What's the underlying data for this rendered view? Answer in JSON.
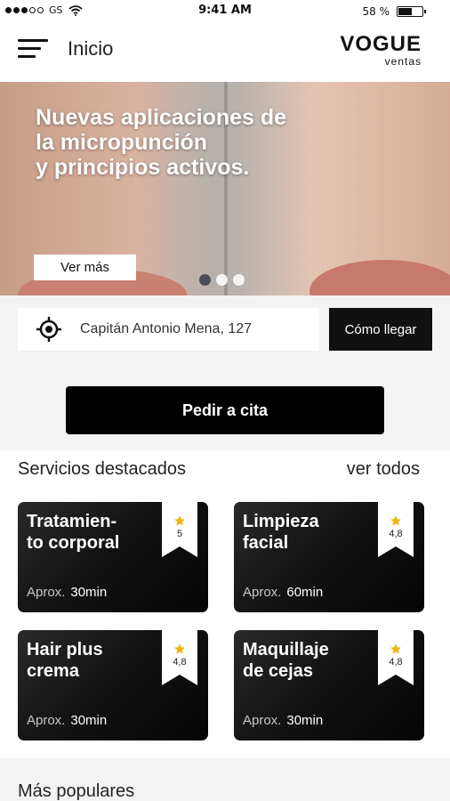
{
  "status": {
    "carrier": "GS",
    "time": "9:41 AM",
    "battery": "58 %"
  },
  "header": {
    "title": "Inicio",
    "brand": "VOGUE",
    "brand_sub": "ventas"
  },
  "hero": {
    "headline": [
      "Nuevas aplicaciones de",
      "la micropunción",
      "y principios activos."
    ],
    "button": "Ver más",
    "slides": 3,
    "active_slide": 1
  },
  "location": {
    "address": "Capitán Antonio Mena, 127",
    "route_button": "Cómo llegar"
  },
  "cta": {
    "label": "Pedir a cita"
  },
  "featured": {
    "title": "Servicios destacados",
    "see_all": "ver todos",
    "duration_label": "Aprox.",
    "items": [
      {
        "name": [
          "Tratamien-",
          "to corporal"
        ],
        "rating": "5",
        "duration": "30min"
      },
      {
        "name": [
          "Limpieza",
          "facial"
        ],
        "rating": "4,8",
        "duration": "60min"
      },
      {
        "name": [
          "Hair plus",
          "crema"
        ],
        "rating": "4,8",
        "duration": "30min"
      },
      {
        "name": [
          "Maquillaje",
          "de cejas"
        ],
        "rating": "4,8",
        "duration": "30min"
      }
    ]
  },
  "popular": {
    "title": "Más populares"
  },
  "colors": {
    "accent": "#000000",
    "star": "#f5b400",
    "background": "#f4f3f3"
  }
}
